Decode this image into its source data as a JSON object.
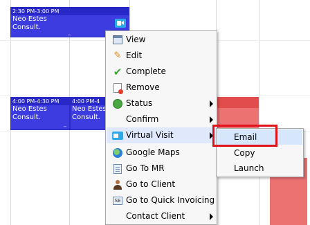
{
  "appointments": [
    {
      "time": "2:30 PM-3:00 PM",
      "name": "Neo Estes",
      "type": "Consult."
    },
    {
      "time": "4:00 PM-4:30 PM",
      "name": "Neo Estes",
      "type": "Consult."
    },
    {
      "time": "4:00 PM-4",
      "name": "Neo Estes",
      "type": "Consult."
    }
  ],
  "context_menu": {
    "items": [
      {
        "label": "View",
        "icon": "view-icon"
      },
      {
        "label": "Edit",
        "icon": "edit-pencil-icon"
      },
      {
        "label": "Complete",
        "icon": "checkmark-icon"
      },
      {
        "label": "Remove",
        "icon": "remove-icon"
      },
      {
        "label": "Status",
        "icon": "status-icon",
        "has_submenu": true
      },
      {
        "label": "Confirm",
        "has_submenu": true
      },
      {
        "label": "Virtual Visit",
        "icon": "video-camera-icon",
        "has_submenu": true,
        "highlighted": true
      },
      {
        "label": "Google Maps",
        "icon": "globe-icon"
      },
      {
        "label": "Go To MR",
        "icon": "document-icon"
      },
      {
        "label": "Go to Client",
        "icon": "person-icon"
      },
      {
        "label": "Go to Quick Invoicing",
        "icon": "invoice-icon"
      },
      {
        "label": "Contact Client",
        "has_submenu": true
      }
    ]
  },
  "submenu": {
    "items": [
      {
        "label": "Email",
        "selected": true
      },
      {
        "label": "Copy"
      },
      {
        "label": "Launch"
      }
    ]
  },
  "colors": {
    "appointment": "#3c3ce0",
    "status_red": "#e24c4c",
    "highlight_box": "#e0121c",
    "video_icon": "#29a9e8"
  }
}
